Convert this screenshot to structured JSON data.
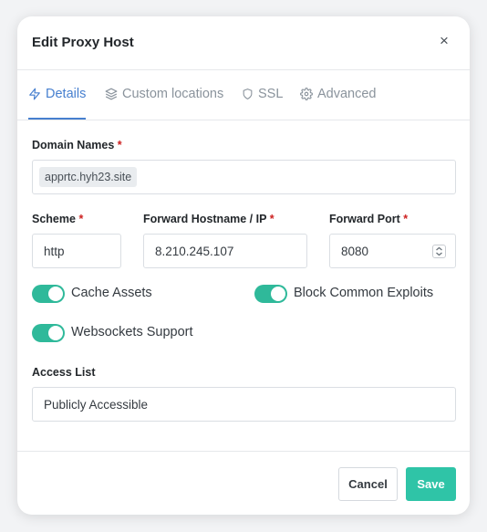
{
  "modal": {
    "title": "Edit Proxy Host",
    "close_symbol": "×"
  },
  "tabs": [
    {
      "label": "Details",
      "icon": "lightning-icon",
      "active": true
    },
    {
      "label": "Custom locations",
      "icon": "layers-icon",
      "active": false
    },
    {
      "label": "SSL",
      "icon": "shield-icon",
      "active": false
    },
    {
      "label": "Advanced",
      "icon": "gear-icon",
      "active": false
    }
  ],
  "form": {
    "domain_names": {
      "label": "Domain Names",
      "required_mark": "*",
      "values": [
        "apprtc.hyh23.site"
      ]
    },
    "scheme": {
      "label": "Scheme",
      "required_mark": "*",
      "value": "http"
    },
    "forward_hostname": {
      "label": "Forward Hostname / IP",
      "required_mark": "*",
      "value": "8.210.245.107"
    },
    "forward_port": {
      "label": "Forward Port",
      "required_mark": "*",
      "value": "8080"
    },
    "toggles": [
      {
        "label": "Cache Assets",
        "on": true
      },
      {
        "label": "Block Common Exploits",
        "on": true
      },
      {
        "label": "Websockets Support",
        "on": true
      }
    ],
    "access_list": {
      "label": "Access List",
      "value": "Publicly Accessible"
    }
  },
  "footer": {
    "cancel_label": "Cancel",
    "save_label": "Save"
  },
  "colors": {
    "accent_blue": "#467fcf",
    "toggle_teal": "#2fb99a",
    "save_teal": "#2fc4a7",
    "required_red": "#cd201f"
  }
}
